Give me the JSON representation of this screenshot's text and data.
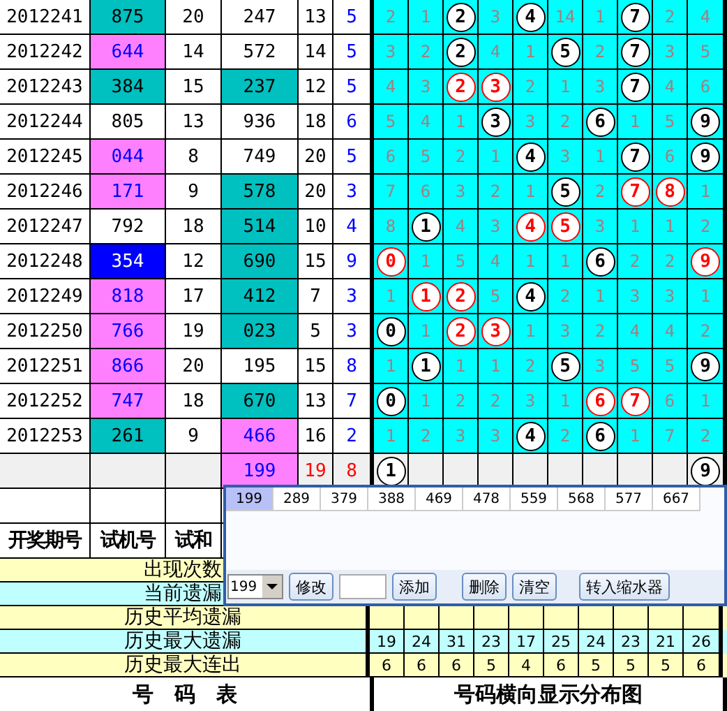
{
  "number_table": {
    "rows": [
      {
        "period": "2012241",
        "trial": {
          "text": "875",
          "color": "#00c0c0"
        },
        "sum": "20",
        "column_4": {
          "text": "247",
          "color": "#ffffff"
        },
        "column_5": "13",
        "column_6": "5"
      },
      {
        "period": "2012242",
        "trial": {
          "text": "644",
          "color": "#ff80ff"
        },
        "sum": "14",
        "column_4": {
          "text": "572",
          "color": "#ffffff"
        },
        "column_5": "14",
        "column_6": "5"
      },
      {
        "period": "2012243",
        "trial": {
          "text": "384",
          "color": "#00c0c0"
        },
        "sum": "15",
        "column_4": {
          "text": "237",
          "color": "#00c0c0"
        },
        "column_5": "12",
        "column_6": "5"
      },
      {
        "period": "2012244",
        "trial": {
          "text": "805",
          "color": "#ffffff"
        },
        "sum": "13",
        "column_4": {
          "text": "936",
          "color": "#ffffff"
        },
        "column_5": "18",
        "column_6": "6"
      },
      {
        "period": "2012245",
        "trial": {
          "text": "044",
          "color": "#ff80ff"
        },
        "sum": "8",
        "column_4": {
          "text": "749",
          "color": "#ffffff"
        },
        "column_5": "20",
        "column_6": "5"
      },
      {
        "period": "2012246",
        "trial": {
          "text": "171",
          "color": "#ff80ff"
        },
        "sum": "9",
        "column_4": {
          "text": "578",
          "color": "#00c0c0"
        },
        "column_5": "20",
        "column_6": "3"
      },
      {
        "period": "2012247",
        "trial": {
          "text": "792",
          "color": "#ffffff"
        },
        "sum": "18",
        "column_4": {
          "text": "514",
          "color": "#00c0c0"
        },
        "column_5": "10",
        "column_6": "4"
      },
      {
        "period": "2012248",
        "trial": {
          "text": "354",
          "color": "#0000ff"
        },
        "sum": "12",
        "column_4": {
          "text": "690",
          "color": "#00c0c0"
        },
        "column_5": "15",
        "column_6": "9"
      },
      {
        "period": "2012249",
        "trial": {
          "text": "818",
          "color": "#ff80ff"
        },
        "sum": "17",
        "column_4": {
          "text": "412",
          "color": "#00c0c0"
        },
        "column_5": "7",
        "column_6": "3"
      },
      {
        "period": "2012250",
        "trial": {
          "text": "766",
          "color": "#ff80ff"
        },
        "sum": "19",
        "column_4": {
          "text": "023",
          "color": "#00c0c0"
        },
        "column_5": "5",
        "column_6": "3"
      },
      {
        "period": "2012251",
        "trial": {
          "text": "866",
          "color": "#ff80ff"
        },
        "sum": "20",
        "column_4": {
          "text": "195",
          "color": "#ffffff"
        },
        "column_5": "15",
        "column_6": "8"
      },
      {
        "period": "2012252",
        "trial": {
          "text": "747",
          "color": "#ff80ff"
        },
        "sum": "18",
        "column_4": {
          "text": "670",
          "color": "#00c0c0"
        },
        "column_5": "13",
        "column_6": "7"
      },
      {
        "period": "2012253",
        "trial": {
          "text": "261",
          "color": "#00c0c0"
        },
        "sum": "9",
        "column_4": {
          "text": "466",
          "color": "#ff80ff"
        },
        "column_5": "16",
        "column_6": "2"
      }
    ],
    "summary": {
      "column_4": {
        "text": "199",
        "color": "#ff80ff"
      },
      "column_5": "19",
      "column_6": "8"
    },
    "headers": [
      "开奖期号",
      "试机号",
      "试和"
    ],
    "footer": "号　码　表"
  },
  "distribution": {
    "rows": [
      [
        {
          "text": "2",
          "kind": "plain"
        },
        {
          "text": "1",
          "kind": "plain"
        },
        {
          "text": "2",
          "kind": "ball"
        },
        {
          "text": "3",
          "kind": "plain"
        },
        {
          "text": "4",
          "kind": "ball"
        },
        {
          "text": "14",
          "kind": "plain"
        },
        {
          "text": "1",
          "kind": "plain"
        },
        {
          "text": "7",
          "kind": "ball"
        },
        {
          "text": "2",
          "kind": "plain"
        },
        {
          "text": "4",
          "kind": "plain"
        }
      ],
      [
        {
          "text": "3",
          "kind": "plain"
        },
        {
          "text": "2",
          "kind": "plain"
        },
        {
          "text": "2",
          "kind": "ball"
        },
        {
          "text": "4",
          "kind": "plain"
        },
        {
          "text": "1",
          "kind": "plain"
        },
        {
          "text": "5",
          "kind": "ball"
        },
        {
          "text": "2",
          "kind": "plain"
        },
        {
          "text": "7",
          "kind": "ball"
        },
        {
          "text": "3",
          "kind": "plain"
        },
        {
          "text": "5",
          "kind": "plain"
        }
      ],
      [
        {
          "text": "4",
          "kind": "plain"
        },
        {
          "text": "3",
          "kind": "plain"
        },
        {
          "text": "2",
          "kind": "red_ball"
        },
        {
          "text": "3",
          "kind": "red_ball"
        },
        {
          "text": "2",
          "kind": "plain"
        },
        {
          "text": "1",
          "kind": "plain"
        },
        {
          "text": "3",
          "kind": "plain"
        },
        {
          "text": "7",
          "kind": "ball"
        },
        {
          "text": "4",
          "kind": "plain"
        },
        {
          "text": "6",
          "kind": "plain"
        }
      ],
      [
        {
          "text": "5",
          "kind": "plain"
        },
        {
          "text": "4",
          "kind": "plain"
        },
        {
          "text": "1",
          "kind": "plain"
        },
        {
          "text": "3",
          "kind": "ball"
        },
        {
          "text": "3",
          "kind": "plain"
        },
        {
          "text": "2",
          "kind": "plain"
        },
        {
          "text": "6",
          "kind": "ball"
        },
        {
          "text": "1",
          "kind": "plain"
        },
        {
          "text": "5",
          "kind": "plain"
        },
        {
          "text": "9",
          "kind": "ball"
        }
      ],
      [
        {
          "text": "6",
          "kind": "plain"
        },
        {
          "text": "5",
          "kind": "plain"
        },
        {
          "text": "2",
          "kind": "plain"
        },
        {
          "text": "1",
          "kind": "plain"
        },
        {
          "text": "4",
          "kind": "ball"
        },
        {
          "text": "3",
          "kind": "plain"
        },
        {
          "text": "1",
          "kind": "plain"
        },
        {
          "text": "7",
          "kind": "ball"
        },
        {
          "text": "6",
          "kind": "plain"
        },
        {
          "text": "9",
          "kind": "ball"
        }
      ],
      [
        {
          "text": "7",
          "kind": "plain"
        },
        {
          "text": "6",
          "kind": "plain"
        },
        {
          "text": "3",
          "kind": "plain"
        },
        {
          "text": "2",
          "kind": "plain"
        },
        {
          "text": "1",
          "kind": "plain"
        },
        {
          "text": "5",
          "kind": "ball"
        },
        {
          "text": "2",
          "kind": "plain"
        },
        {
          "text": "7",
          "kind": "red_ball"
        },
        {
          "text": "8",
          "kind": "red_ball"
        },
        {
          "text": "1",
          "kind": "plain"
        }
      ],
      [
        {
          "text": "8",
          "kind": "plain"
        },
        {
          "text": "1",
          "kind": "ball"
        },
        {
          "text": "4",
          "kind": "plain"
        },
        {
          "text": "3",
          "kind": "plain"
        },
        {
          "text": "4",
          "kind": "red_ball"
        },
        {
          "text": "5",
          "kind": "red_ball"
        },
        {
          "text": "3",
          "kind": "plain"
        },
        {
          "text": "1",
          "kind": "plain"
        },
        {
          "text": "1",
          "kind": "plain"
        },
        {
          "text": "2",
          "kind": "plain"
        }
      ],
      [
        {
          "text": "0",
          "kind": "red_ball"
        },
        {
          "text": "1",
          "kind": "plain"
        },
        {
          "text": "5",
          "kind": "plain"
        },
        {
          "text": "4",
          "kind": "plain"
        },
        {
          "text": "1",
          "kind": "plain"
        },
        {
          "text": "1",
          "kind": "plain"
        },
        {
          "text": "6",
          "kind": "ball"
        },
        {
          "text": "2",
          "kind": "plain"
        },
        {
          "text": "2",
          "kind": "plain"
        },
        {
          "text": "9",
          "kind": "red_ball"
        }
      ],
      [
        {
          "text": "1",
          "kind": "plain"
        },
        {
          "text": "1",
          "kind": "red_ball"
        },
        {
          "text": "2",
          "kind": "red_ball"
        },
        {
          "text": "5",
          "kind": "plain"
        },
        {
          "text": "4",
          "kind": "ball"
        },
        {
          "text": "2",
          "kind": "plain"
        },
        {
          "text": "1",
          "kind": "plain"
        },
        {
          "text": "3",
          "kind": "plain"
        },
        {
          "text": "3",
          "kind": "plain"
        },
        {
          "text": "1",
          "kind": "plain"
        }
      ],
      [
        {
          "text": "0",
          "kind": "ball"
        },
        {
          "text": "1",
          "kind": "plain"
        },
        {
          "text": "2",
          "kind": "red_ball"
        },
        {
          "text": "3",
          "kind": "red_ball"
        },
        {
          "text": "1",
          "kind": "plain"
        },
        {
          "text": "3",
          "kind": "plain"
        },
        {
          "text": "2",
          "kind": "plain"
        },
        {
          "text": "4",
          "kind": "plain"
        },
        {
          "text": "4",
          "kind": "plain"
        },
        {
          "text": "2",
          "kind": "plain"
        }
      ],
      [
        {
          "text": "1",
          "kind": "plain"
        },
        {
          "text": "1",
          "kind": "ball"
        },
        {
          "text": "1",
          "kind": "plain"
        },
        {
          "text": "1",
          "kind": "plain"
        },
        {
          "text": "2",
          "kind": "plain"
        },
        {
          "text": "5",
          "kind": "ball"
        },
        {
          "text": "3",
          "kind": "plain"
        },
        {
          "text": "5",
          "kind": "plain"
        },
        {
          "text": "5",
          "kind": "plain"
        },
        {
          "text": "9",
          "kind": "ball"
        }
      ],
      [
        {
          "text": "0",
          "kind": "ball"
        },
        {
          "text": "1",
          "kind": "plain"
        },
        {
          "text": "2",
          "kind": "plain"
        },
        {
          "text": "2",
          "kind": "plain"
        },
        {
          "text": "3",
          "kind": "plain"
        },
        {
          "text": "1",
          "kind": "plain"
        },
        {
          "text": "6",
          "kind": "red_ball"
        },
        {
          "text": "7",
          "kind": "red_ball"
        },
        {
          "text": "6",
          "kind": "plain"
        },
        {
          "text": "1",
          "kind": "plain"
        }
      ],
      [
        {
          "text": "1",
          "kind": "plain"
        },
        {
          "text": "2",
          "kind": "plain"
        },
        {
          "text": "3",
          "kind": "plain"
        },
        {
          "text": "3",
          "kind": "plain"
        },
        {
          "text": "4",
          "kind": "ball"
        },
        {
          "text": "2",
          "kind": "plain"
        },
        {
          "text": "6",
          "kind": "ball"
        },
        {
          "text": "1",
          "kind": "plain"
        },
        {
          "text": "7",
          "kind": "plain"
        },
        {
          "text": "2",
          "kind": "plain"
        }
      ]
    ],
    "summary": [
      {
        "text": "1",
        "kind": "ball"
      },
      {
        "kind": "blank"
      },
      {
        "kind": "blank"
      },
      {
        "kind": "blank"
      },
      {
        "kind": "blank"
      },
      {
        "kind": "blank"
      },
      {
        "kind": "blank"
      },
      {
        "kind": "blank"
      },
      {
        "kind": "blank"
      },
      {
        "text": "9",
        "kind": "ball"
      }
    ],
    "footer": "号码横向显示分布图"
  },
  "statistics": [
    {
      "label": "出现次数"
    },
    {
      "label": "当前遗漏"
    },
    {
      "label": "历史平均遗漏"
    },
    {
      "label": "历史最大遗漏",
      "values": [
        "19",
        "24",
        "31",
        "23",
        "17",
        "25",
        "24",
        "23",
        "21",
        "26"
      ]
    },
    {
      "label": "历史最大连出",
      "values": [
        "6",
        "6",
        "6",
        "5",
        "4",
        "6",
        "5",
        "5",
        "5",
        "6"
      ]
    }
  ],
  "popup": {
    "numbers": [
      {
        "text": "199",
        "selected": true
      },
      {
        "text": "289",
        "selected": false
      },
      {
        "text": "379",
        "selected": false
      },
      {
        "text": "388",
        "selected": false
      },
      {
        "text": "469",
        "selected": false
      },
      {
        "text": "478",
        "selected": false
      },
      {
        "text": "559",
        "selected": false
      },
      {
        "text": "568",
        "selected": false
      },
      {
        "text": "577",
        "selected": false
      },
      {
        "text": "667",
        "selected": false
      }
    ],
    "combo_value": "199",
    "edit_button": "修改",
    "add_button": "添加",
    "delete_button": "删除",
    "clear_button": "清空",
    "transfer_button": "转入缩水器"
  }
}
